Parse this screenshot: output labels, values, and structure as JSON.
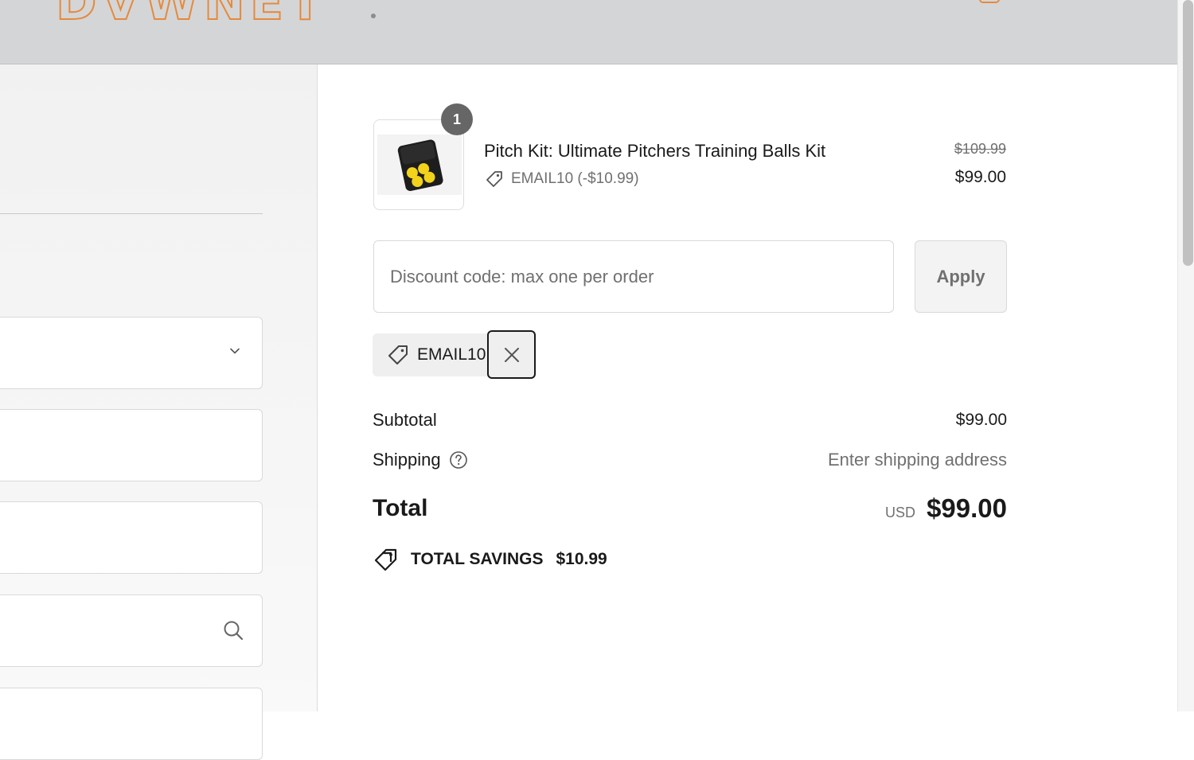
{
  "brand": {
    "logo_text": "DVWNET",
    "accent_color": "#e58a3c"
  },
  "order": {
    "item": {
      "quantity": "1",
      "title": "Pitch Kit: Ultimate Pitchers Training Balls Kit",
      "discount_note": "EMAIL10 (-$10.99)",
      "original_price": "$109.99",
      "price": "$99.00"
    },
    "discount": {
      "placeholder": "Discount code: max one per order",
      "value": "",
      "apply_label": "Apply",
      "applied_code": "EMAIL10"
    },
    "summary": {
      "subtotal_label": "Subtotal",
      "subtotal_value": "$99.00",
      "shipping_label": "Shipping",
      "shipping_value": "Enter shipping address",
      "total_label": "Total",
      "currency": "USD",
      "total_value": "$99.00",
      "savings_label": "TOTAL SAVINGS",
      "savings_value": "$10.99"
    }
  },
  "icons": {
    "tag": "tag-icon",
    "close": "close-icon",
    "help": "help-circle-icon",
    "savings": "savings-tag-icon",
    "chevron": "chevron-down-icon",
    "search": "search-icon",
    "cart": "cart-icon"
  }
}
